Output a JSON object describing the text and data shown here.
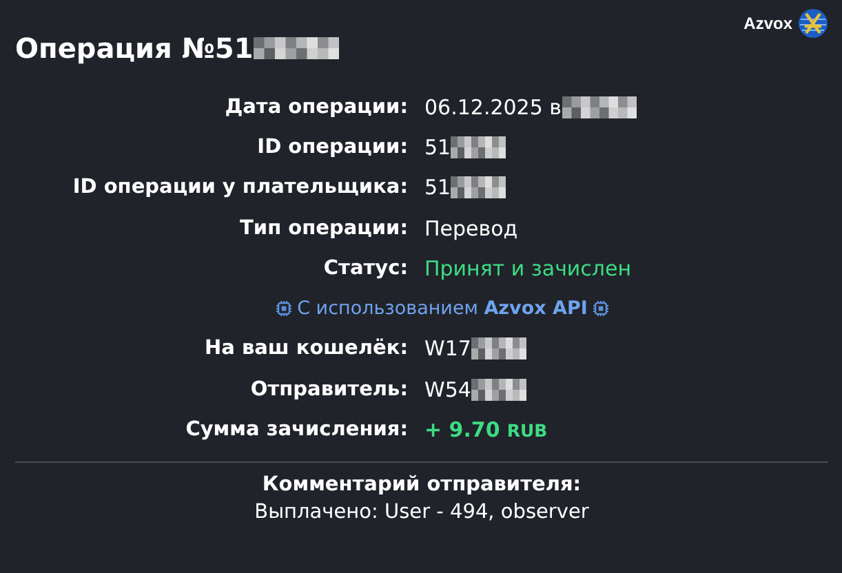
{
  "header": {
    "title": "Операция №51",
    "title_redacted": true,
    "brand": "Azvox"
  },
  "rows": [
    {
      "kind": "field",
      "label": "Дата операции:",
      "value": "06.12.2025 в",
      "redacted": true
    },
    {
      "kind": "field",
      "label": "ID операции:",
      "value": "51",
      "redacted": true
    },
    {
      "kind": "field",
      "label": "ID операции у плательщика:",
      "value": "51",
      "redacted": true
    },
    {
      "kind": "field",
      "label": "Тип операции:",
      "value": "Перевод",
      "redacted": false
    },
    {
      "kind": "status",
      "label": "Статус:",
      "value": "Принят и зачислен",
      "redacted": false
    },
    {
      "kind": "api",
      "text": "С использованием **Azvox API**"
    },
    {
      "kind": "field",
      "label": "На ваш кошелёк:",
      "value": "W17",
      "redacted": true
    },
    {
      "kind": "field",
      "label": "Отправитель:",
      "value": "W54",
      "redacted": true
    },
    {
      "kind": "amount",
      "label": "Сумма зачисления:",
      "value": "+ 9.70",
      "currency": "RUB"
    }
  ],
  "comment": {
    "title": "Комментарий отправителя:",
    "text": "Выплачено: User - 494, observer"
  }
}
